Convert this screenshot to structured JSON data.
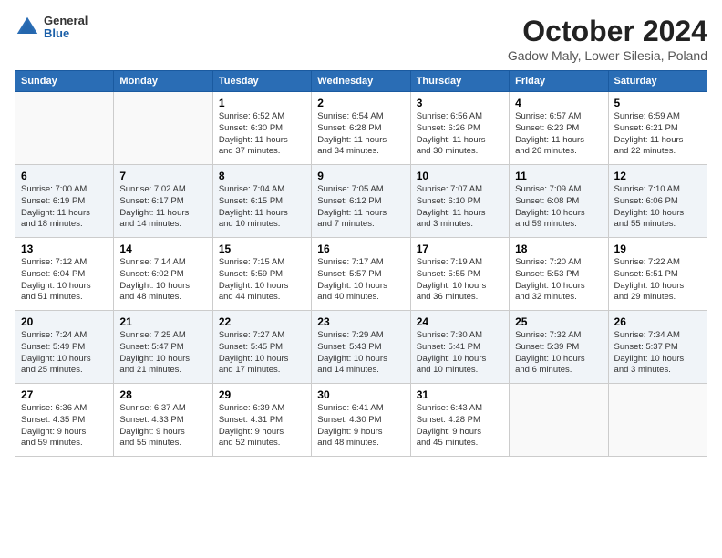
{
  "header": {
    "logo_line1": "General",
    "logo_line2": "Blue",
    "title": "October 2024",
    "location": "Gadow Maly, Lower Silesia, Poland"
  },
  "columns": [
    "Sunday",
    "Monday",
    "Tuesday",
    "Wednesday",
    "Thursday",
    "Friday",
    "Saturday"
  ],
  "weeks": [
    [
      {
        "day": "",
        "info": ""
      },
      {
        "day": "",
        "info": ""
      },
      {
        "day": "1",
        "info": "Sunrise: 6:52 AM\nSunset: 6:30 PM\nDaylight: 11 hours\nand 37 minutes."
      },
      {
        "day": "2",
        "info": "Sunrise: 6:54 AM\nSunset: 6:28 PM\nDaylight: 11 hours\nand 34 minutes."
      },
      {
        "day": "3",
        "info": "Sunrise: 6:56 AM\nSunset: 6:26 PM\nDaylight: 11 hours\nand 30 minutes."
      },
      {
        "day": "4",
        "info": "Sunrise: 6:57 AM\nSunset: 6:23 PM\nDaylight: 11 hours\nand 26 minutes."
      },
      {
        "day": "5",
        "info": "Sunrise: 6:59 AM\nSunset: 6:21 PM\nDaylight: 11 hours\nand 22 minutes."
      }
    ],
    [
      {
        "day": "6",
        "info": "Sunrise: 7:00 AM\nSunset: 6:19 PM\nDaylight: 11 hours\nand 18 minutes."
      },
      {
        "day": "7",
        "info": "Sunrise: 7:02 AM\nSunset: 6:17 PM\nDaylight: 11 hours\nand 14 minutes."
      },
      {
        "day": "8",
        "info": "Sunrise: 7:04 AM\nSunset: 6:15 PM\nDaylight: 11 hours\nand 10 minutes."
      },
      {
        "day": "9",
        "info": "Sunrise: 7:05 AM\nSunset: 6:12 PM\nDaylight: 11 hours\nand 7 minutes."
      },
      {
        "day": "10",
        "info": "Sunrise: 7:07 AM\nSunset: 6:10 PM\nDaylight: 11 hours\nand 3 minutes."
      },
      {
        "day": "11",
        "info": "Sunrise: 7:09 AM\nSunset: 6:08 PM\nDaylight: 10 hours\nand 59 minutes."
      },
      {
        "day": "12",
        "info": "Sunrise: 7:10 AM\nSunset: 6:06 PM\nDaylight: 10 hours\nand 55 minutes."
      }
    ],
    [
      {
        "day": "13",
        "info": "Sunrise: 7:12 AM\nSunset: 6:04 PM\nDaylight: 10 hours\nand 51 minutes."
      },
      {
        "day": "14",
        "info": "Sunrise: 7:14 AM\nSunset: 6:02 PM\nDaylight: 10 hours\nand 48 minutes."
      },
      {
        "day": "15",
        "info": "Sunrise: 7:15 AM\nSunset: 5:59 PM\nDaylight: 10 hours\nand 44 minutes."
      },
      {
        "day": "16",
        "info": "Sunrise: 7:17 AM\nSunset: 5:57 PM\nDaylight: 10 hours\nand 40 minutes."
      },
      {
        "day": "17",
        "info": "Sunrise: 7:19 AM\nSunset: 5:55 PM\nDaylight: 10 hours\nand 36 minutes."
      },
      {
        "day": "18",
        "info": "Sunrise: 7:20 AM\nSunset: 5:53 PM\nDaylight: 10 hours\nand 32 minutes."
      },
      {
        "day": "19",
        "info": "Sunrise: 7:22 AM\nSunset: 5:51 PM\nDaylight: 10 hours\nand 29 minutes."
      }
    ],
    [
      {
        "day": "20",
        "info": "Sunrise: 7:24 AM\nSunset: 5:49 PM\nDaylight: 10 hours\nand 25 minutes."
      },
      {
        "day": "21",
        "info": "Sunrise: 7:25 AM\nSunset: 5:47 PM\nDaylight: 10 hours\nand 21 minutes."
      },
      {
        "day": "22",
        "info": "Sunrise: 7:27 AM\nSunset: 5:45 PM\nDaylight: 10 hours\nand 17 minutes."
      },
      {
        "day": "23",
        "info": "Sunrise: 7:29 AM\nSunset: 5:43 PM\nDaylight: 10 hours\nand 14 minutes."
      },
      {
        "day": "24",
        "info": "Sunrise: 7:30 AM\nSunset: 5:41 PM\nDaylight: 10 hours\nand 10 minutes."
      },
      {
        "day": "25",
        "info": "Sunrise: 7:32 AM\nSunset: 5:39 PM\nDaylight: 10 hours\nand 6 minutes."
      },
      {
        "day": "26",
        "info": "Sunrise: 7:34 AM\nSunset: 5:37 PM\nDaylight: 10 hours\nand 3 minutes."
      }
    ],
    [
      {
        "day": "27",
        "info": "Sunrise: 6:36 AM\nSunset: 4:35 PM\nDaylight: 9 hours\nand 59 minutes."
      },
      {
        "day": "28",
        "info": "Sunrise: 6:37 AM\nSunset: 4:33 PM\nDaylight: 9 hours\nand 55 minutes."
      },
      {
        "day": "29",
        "info": "Sunrise: 6:39 AM\nSunset: 4:31 PM\nDaylight: 9 hours\nand 52 minutes."
      },
      {
        "day": "30",
        "info": "Sunrise: 6:41 AM\nSunset: 4:30 PM\nDaylight: 9 hours\nand 48 minutes."
      },
      {
        "day": "31",
        "info": "Sunrise: 6:43 AM\nSunset: 4:28 PM\nDaylight: 9 hours\nand 45 minutes."
      },
      {
        "day": "",
        "info": ""
      },
      {
        "day": "",
        "info": ""
      }
    ]
  ]
}
